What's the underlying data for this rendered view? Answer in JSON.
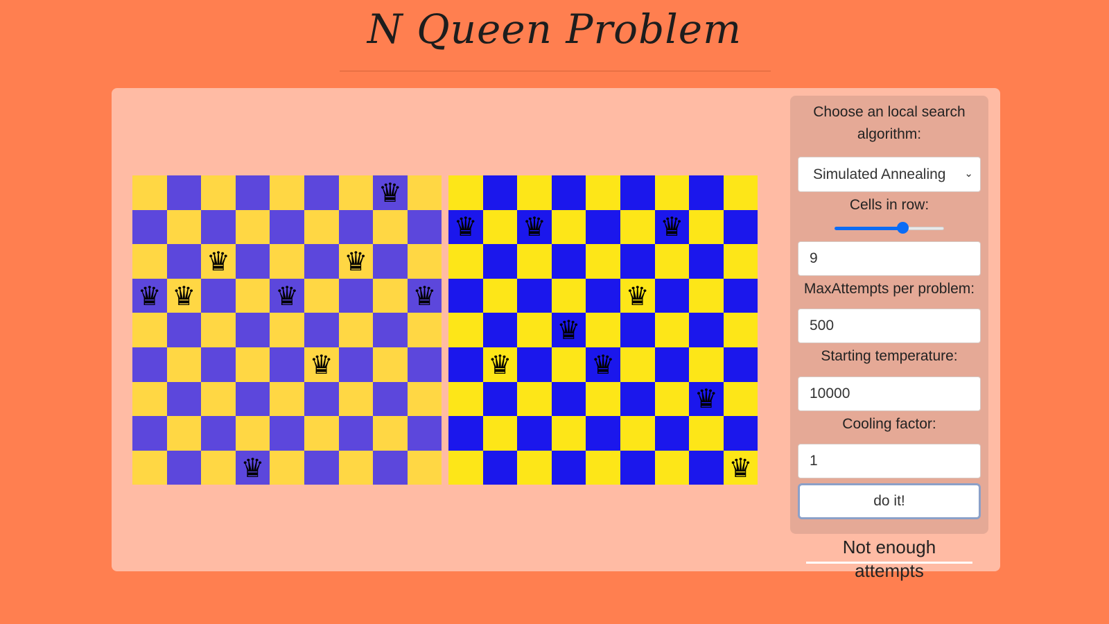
{
  "page": {
    "title": "N Queen Problem"
  },
  "boards": [
    {
      "name": "left",
      "size": 9,
      "colors": {
        "light": "#ffd744",
        "dark": "#5c47dc"
      },
      "queen_positions": [
        [
          3,
          0
        ],
        [
          3,
          1
        ],
        [
          2,
          2
        ],
        [
          8,
          3
        ],
        [
          3,
          4
        ],
        [
          5,
          5
        ],
        [
          2,
          6
        ],
        [
          0,
          7
        ],
        [
          3,
          8
        ]
      ]
    },
    {
      "name": "right",
      "size": 9,
      "colors": {
        "light": "#fde618",
        "dark": "#1b17ec"
      },
      "queen_positions": [
        [
          1,
          0
        ],
        [
          5,
          1
        ],
        [
          1,
          2
        ],
        [
          4,
          3
        ],
        [
          5,
          4
        ],
        [
          3,
          5
        ],
        [
          1,
          6
        ],
        [
          6,
          7
        ],
        [
          8,
          8
        ]
      ]
    }
  ],
  "piece_glyph": "♛",
  "controls": {
    "algorithm_label": "Choose an local search algorithm:",
    "algorithm_selected": "Simulated Annealing",
    "cells_label": "Cells in row:",
    "cells_slider_fraction": 0.62,
    "cells_value": "9",
    "max_attempts_label": "MaxAttempts per problem:",
    "max_attempts_value": "500",
    "temperature_label": "Starting temperature:",
    "temperature_value": "10000",
    "cooling_label": "Cooling factor:",
    "cooling_value": "1",
    "run_button_label": "do it!"
  },
  "status": "Not enough attempts",
  "icons": {
    "select_arrow": "chevron-down-icon",
    "piece": "queen-icon"
  }
}
